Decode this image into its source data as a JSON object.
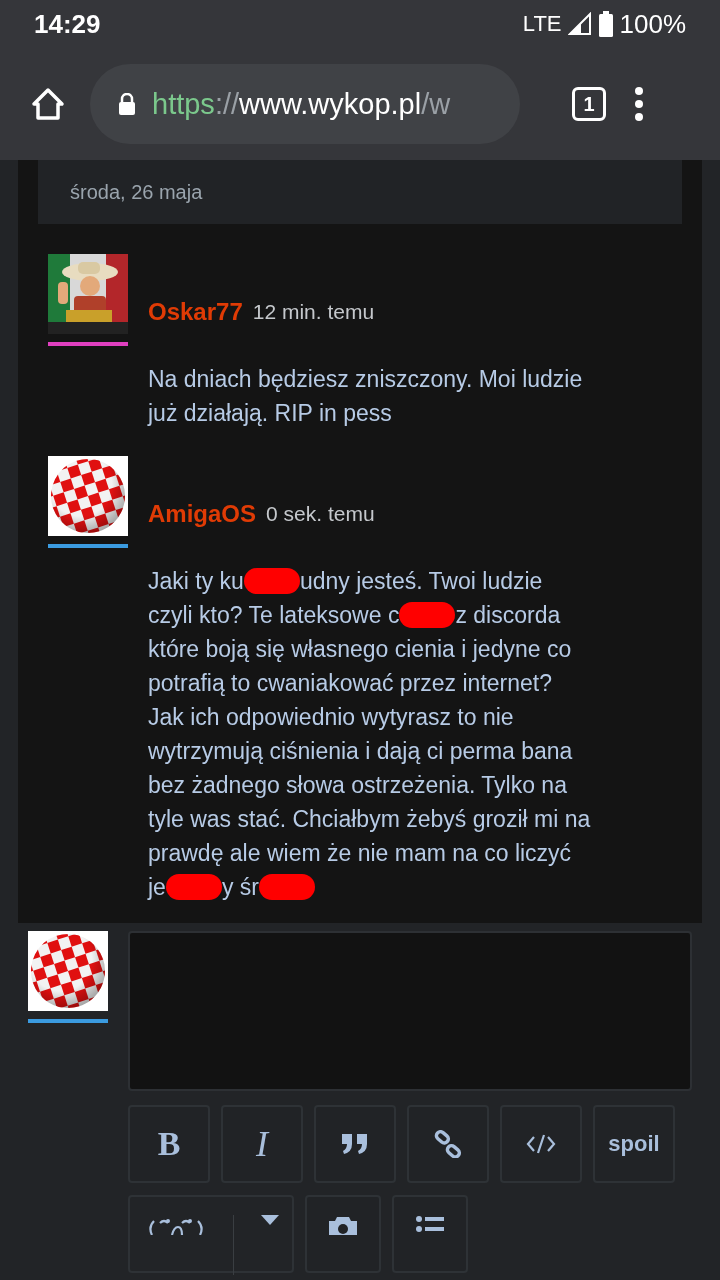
{
  "status_bar": {
    "time": "14:29",
    "network": "LTE",
    "battery": "100%"
  },
  "browser": {
    "url_scheme": "https",
    "url_sep": "://",
    "url_host": "www.wykop.pl",
    "url_rest": "/w",
    "tab_count": "1"
  },
  "date_header": "środa, 26 maja",
  "comments": [
    {
      "author": "Oskar77",
      "time": "12 min. temu",
      "avatar": {
        "kind": "picture"
      },
      "color": "#e040c0",
      "lines": [
        [
          {
            "kind": "text",
            "text": "Na dniach będziesz zniszczony. Moi ludzie"
          }
        ],
        [
          {
            "kind": "text",
            "text": "już działają. RIP in pess"
          }
        ]
      ]
    },
    {
      "author": "AmigaOS",
      "time": "0 sek. temu",
      "avatar": {
        "kind": "ball"
      },
      "color": "#3b9be0",
      "lines": [
        [
          {
            "kind": "text",
            "text": "Jaki ty ku"
          },
          {
            "kind": "redaction"
          },
          {
            "kind": "text",
            "text": "udny jesteś. Twoi ludzie"
          }
        ],
        [
          {
            "kind": "text",
            "text": "czyli kto? Te lateksowe c"
          },
          {
            "kind": "redaction"
          },
          {
            "kind": "text",
            "text": "z discorda"
          }
        ],
        [
          {
            "kind": "text",
            "text": "które boją się własnego cienia i jedyne co"
          }
        ],
        [
          {
            "kind": "text",
            "text": "potrafią to cwaniakować przez internet?"
          }
        ],
        [
          {
            "kind": "text",
            "text": "Jak ich odpowiednio wytyrasz to nie"
          }
        ],
        [
          {
            "kind": "text",
            "text": "wytrzymują ciśnienia i dają ci perma bana"
          }
        ],
        [
          {
            "kind": "text",
            "text": "bez żadnego słowa ostrzeżenia. Tylko na"
          }
        ],
        [
          {
            "kind": "text",
            "text": "tyle was stać. Chciałbym żebyś groził mi na"
          }
        ],
        [
          {
            "kind": "text",
            "text": "prawdę ale wiem że nie mam na co liczyć"
          }
        ],
        [
          {
            "kind": "text",
            "text": "je"
          },
          {
            "kind": "redaction"
          },
          {
            "kind": "text",
            "text": "y śr"
          },
          {
            "kind": "redaction"
          }
        ]
      ]
    }
  ],
  "composer": {
    "avatar": {
      "kind": "ball"
    },
    "color": "#3b9be0",
    "buttons": [
      {
        "kind": "bold",
        "label": "B"
      },
      {
        "kind": "italic",
        "label": "I"
      },
      {
        "kind": "quote"
      },
      {
        "kind": "link"
      },
      {
        "kind": "code"
      },
      {
        "kind": "text",
        "label": "spoil"
      }
    ]
  }
}
